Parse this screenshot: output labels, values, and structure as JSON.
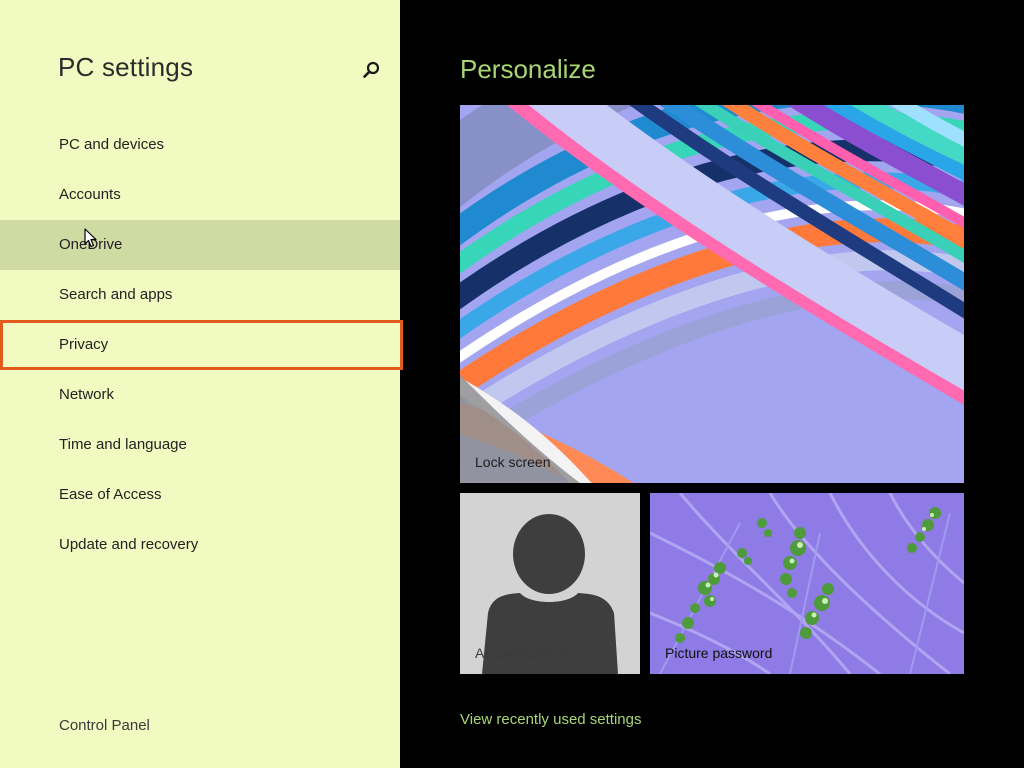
{
  "sidebar": {
    "title": "PC settings",
    "search_icon": "search-icon",
    "items": [
      {
        "label": "PC and devices"
      },
      {
        "label": "Accounts"
      },
      {
        "label": "OneDrive"
      },
      {
        "label": "Search and apps"
      },
      {
        "label": "Privacy"
      },
      {
        "label": "Network"
      },
      {
        "label": "Time and language"
      },
      {
        "label": "Ease of Access"
      },
      {
        "label": "Update and recovery"
      }
    ],
    "selected_item": "OneDrive",
    "highlighted_item": "Privacy",
    "footer_link": "Control Panel"
  },
  "main": {
    "title": "Personalize",
    "tiles": {
      "lock_screen": {
        "label": "Lock screen"
      },
      "account_picture": {
        "label": "Account picture"
      },
      "picture_password": {
        "label": "Picture password"
      }
    },
    "recent_link": "View recently used settings"
  },
  "colors": {
    "sidebar_bg": "#f1fbc1",
    "selected_bg": "#d0dba4",
    "highlight_border": "#e25a1c",
    "accent_green": "#a8d672",
    "main_bg": "#000000"
  }
}
